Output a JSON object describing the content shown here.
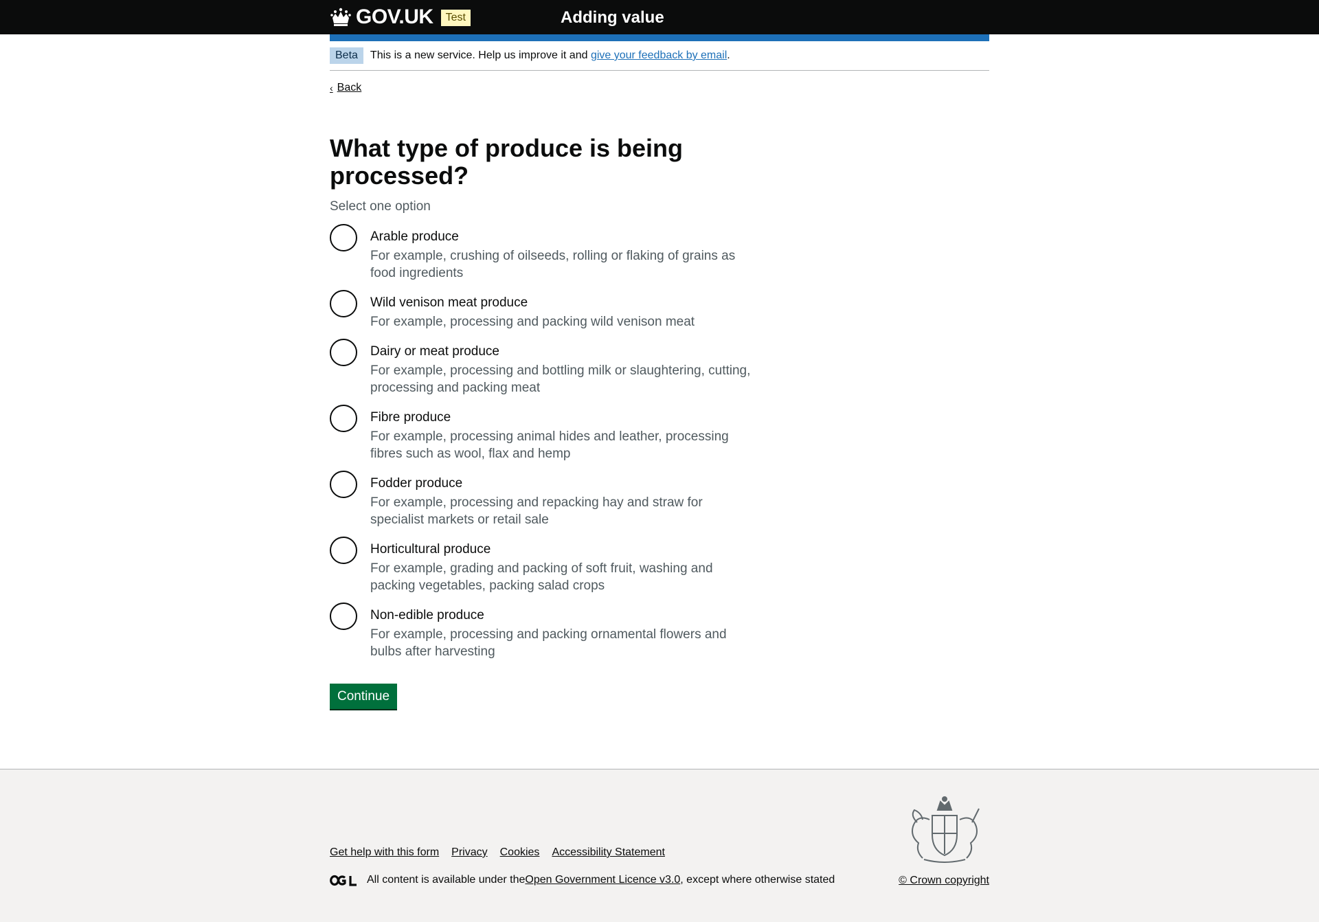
{
  "header": {
    "logo_text": "GOV.UK",
    "env_tag": "Test",
    "service_name": "Adding value"
  },
  "phase_banner": {
    "tag": "Beta",
    "text": "This is a new service. Help us improve it and ",
    "link": "give your feedback by email",
    "suffix": "."
  },
  "back_link": "Back",
  "question": {
    "title": "What type of produce is being processed?",
    "hint": "Select one option"
  },
  "options": [
    {
      "label": "Arable produce",
      "hint": "For example, crushing of oilseeds, rolling or flaking of grains as food ingredients"
    },
    {
      "label": "Wild venison meat produce",
      "hint": "For example, processing and packing wild venison meat"
    },
    {
      "label": "Dairy or meat produce",
      "hint": "For example, processing and bottling milk or slaughtering, cutting, processing and packing meat"
    },
    {
      "label": "Fibre produce",
      "hint": "For example, processing animal hides and leather, processing fibres such as wool, flax and hemp"
    },
    {
      "label": "Fodder produce",
      "hint": "For example, processing and repacking hay and straw for specialist markets or retail sale"
    },
    {
      "label": "Horticultural produce",
      "hint": "For example, grading and packing of soft fruit, washing and packing vegetables, packing salad crops"
    },
    {
      "label": "Non-edible produce",
      "hint": "For example, processing and packing ornamental flowers and bulbs after harvesting"
    }
  ],
  "continue_button": "Continue",
  "footer": {
    "links": [
      "Get help with this form",
      "Privacy",
      "Cookies",
      "Accessibility Statement"
    ],
    "licence_prefix": "All content is available under the ",
    "licence_link": "Open Government Licence v3.0",
    "licence_suffix": ", except where otherwise stated",
    "copyright": "© Crown copyright"
  }
}
